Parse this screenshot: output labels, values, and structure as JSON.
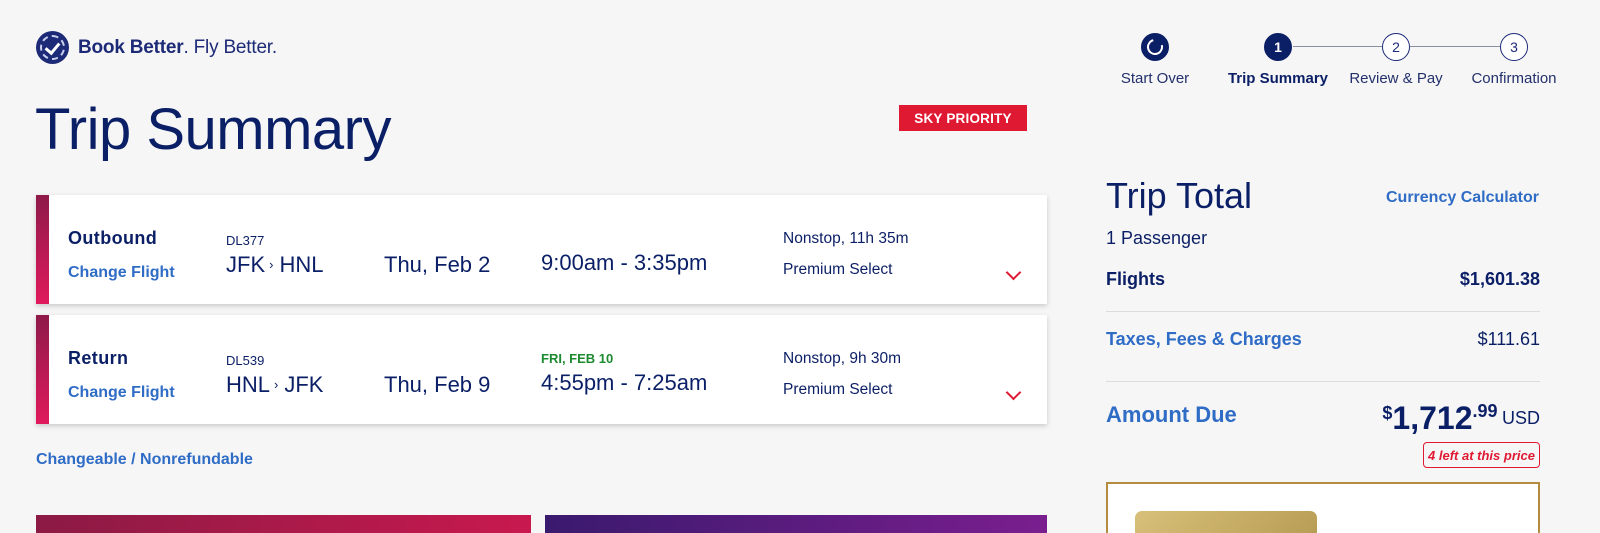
{
  "header": {
    "logo_bold": "Book Better",
    "logo_rest": ". Fly Better."
  },
  "stepper": {
    "start_over": "Start Over",
    "steps": [
      {
        "num": "1",
        "label": "Trip Summary"
      },
      {
        "num": "2",
        "label": "Review & Pay"
      },
      {
        "num": "3",
        "label": "Confirmation"
      }
    ]
  },
  "page": {
    "title": "Trip Summary",
    "badge": "SKY PRIORITY"
  },
  "flights": [
    {
      "direction": "Outbound",
      "change_label": "Change Flight",
      "flight_number": "DL377",
      "origin": "JFK",
      "destination": "HNL",
      "date": "Thu, Feb 2",
      "arrival_date_note": "",
      "times": "9:00am - 3:35pm",
      "stops_duration": "Nonstop, 11h 35m",
      "cabin": "Premium Select"
    },
    {
      "direction": "Return",
      "change_label": "Change Flight",
      "flight_number": "DL539",
      "origin": "HNL",
      "destination": "JFK",
      "date": "Thu, Feb 9",
      "arrival_date_note": "FRI, FEB 10",
      "times": "4:55pm - 7:25am",
      "stops_duration": "Nonstop, 9h 30m",
      "cabin": "Premium Select"
    }
  ],
  "fare_rule": "Changeable / Nonrefundable",
  "trip_total": {
    "title": "Trip Total",
    "currency_calculator": "Currency Calculator",
    "passengers": "1 Passenger",
    "flights_label": "Flights",
    "flights_value": "$1,601.38",
    "taxes_label": "Taxes, Fees & Charges",
    "taxes_value": "$111.61",
    "amount_due_label": "Amount Due",
    "amount_currency_symbol": "$",
    "amount_main": "1,712",
    "amount_cents": ".99",
    "amount_currency": "USD",
    "availability_badge": "4 left at this price"
  },
  "colors": {
    "navy": "#0b1f66",
    "link_blue": "#2f6cc6",
    "delta_red": "#e01933",
    "arrival_green": "#1d8a2f"
  }
}
